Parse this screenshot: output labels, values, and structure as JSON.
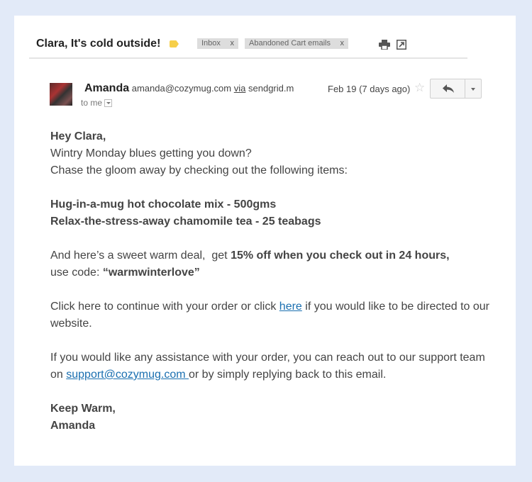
{
  "email": {
    "subject": "Clara, It's cold outside!",
    "labels": [
      {
        "text": "Inbox",
        "remove": "x"
      },
      {
        "text": "Abandoned Cart emails",
        "remove": "x"
      }
    ],
    "sender": {
      "name": "Amanda",
      "address": "amanda@cozymug.com",
      "via_word": "via",
      "via_domain": "sendgrid.m"
    },
    "recipient": "to me",
    "date": "Feb 19 (7 days ago)"
  },
  "body": {
    "greeting": "Hey Clara,",
    "line1": "Wintry Monday blues getting you down?",
    "line2": "Chase the gloom away by checking out the following items:",
    "item1": "Hug-in-a-mug hot chocolate mix - 500gms",
    "item2": "Relax-the-stress-away chamomile tea - 25 teabags",
    "deal_pre": "And here’s a sweet warm deal,  get ",
    "deal_bold": "15% off when you check out in 24 hours,",
    "deal_code_pre": "use code: ",
    "deal_code": "“warmwinterlove”",
    "click_pre": "Click here to continue with your order or click ",
    "click_link": "here",
    "click_post": " if you would like to be directed to our website.",
    "support_pre": "If you would like any assistance with your order, you can reach out to our support team on ",
    "support_link": "support@cozymug.com ",
    "support_post": "or by simply replying back to this email.",
    "signoff": "Keep Warm,",
    "signature": "Amanda"
  },
  "icons": {
    "label": "label-tag-icon",
    "print": "print-icon",
    "popout": "new-window-icon",
    "star": "star-icon",
    "reply": "reply-icon",
    "more": "chevron-down-icon"
  },
  "colors": {
    "background": "#e2eaf8",
    "link": "#1a6fb0",
    "tag": "#f6cf4a"
  }
}
